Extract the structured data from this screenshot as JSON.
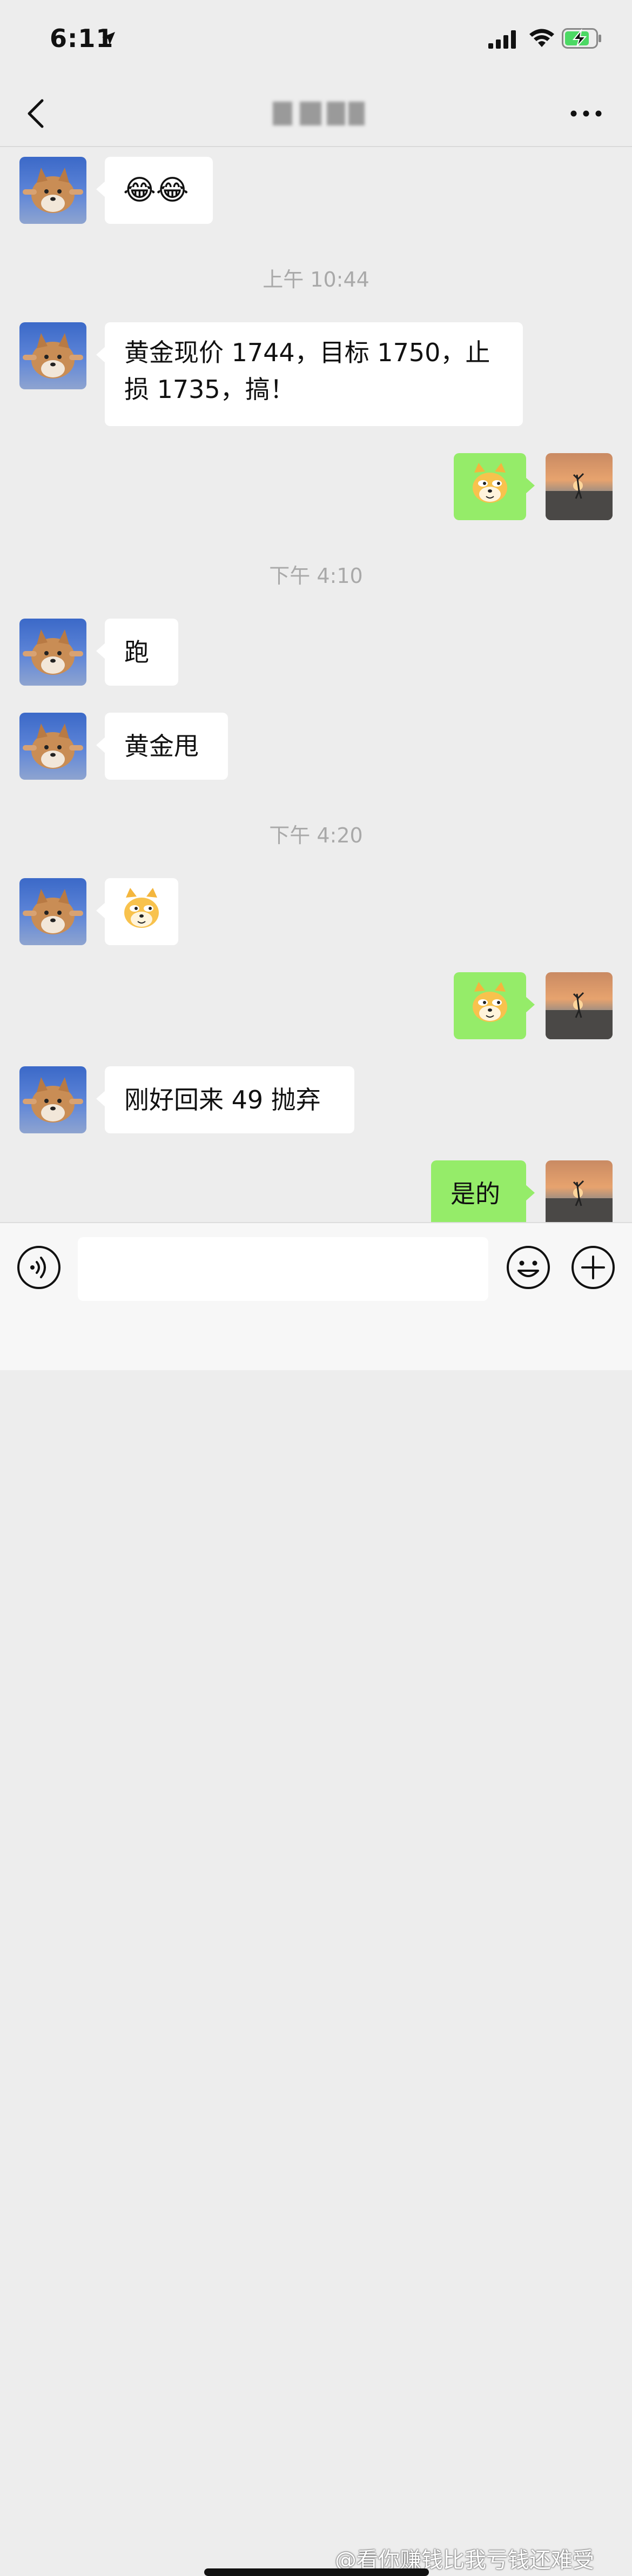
{
  "status_bar": {
    "time": "6:11"
  },
  "nav": {
    "title": ""
  },
  "messages": [
    {
      "from": "them",
      "type": "emoji",
      "content": "😂😂"
    },
    {
      "type": "timestamp",
      "content": "上午 10:44"
    },
    {
      "from": "them",
      "type": "text",
      "lines": [
        "黄金现价 1744，目标 1750，止",
        "损 1735，搞！"
      ]
    },
    {
      "from": "me",
      "type": "sticker",
      "content": "doge-sticker"
    },
    {
      "type": "timestamp",
      "content": "下午 4:10"
    },
    {
      "from": "them",
      "type": "text",
      "lines": [
        "跑"
      ]
    },
    {
      "from": "them",
      "type": "text",
      "lines": [
        "黄金甩"
      ]
    },
    {
      "type": "timestamp",
      "content": "下午 4:20"
    },
    {
      "from": "them",
      "type": "sticker",
      "content": "doge-sticker"
    },
    {
      "from": "me",
      "type": "sticker",
      "content": "doge-sticker"
    },
    {
      "from": "them",
      "type": "text",
      "lines": [
        "刚好回来 49 抛弃"
      ]
    },
    {
      "from": "me",
      "type": "text",
      "lines": [
        "是的"
      ]
    }
  ],
  "input": {
    "value": "",
    "placeholder": ""
  },
  "watermark": "@看你赚钱比我亏钱还难受",
  "colors": {
    "outgoing_bubble": "#95ec69",
    "incoming_bubble": "#ffffff",
    "background": "#ededed"
  }
}
